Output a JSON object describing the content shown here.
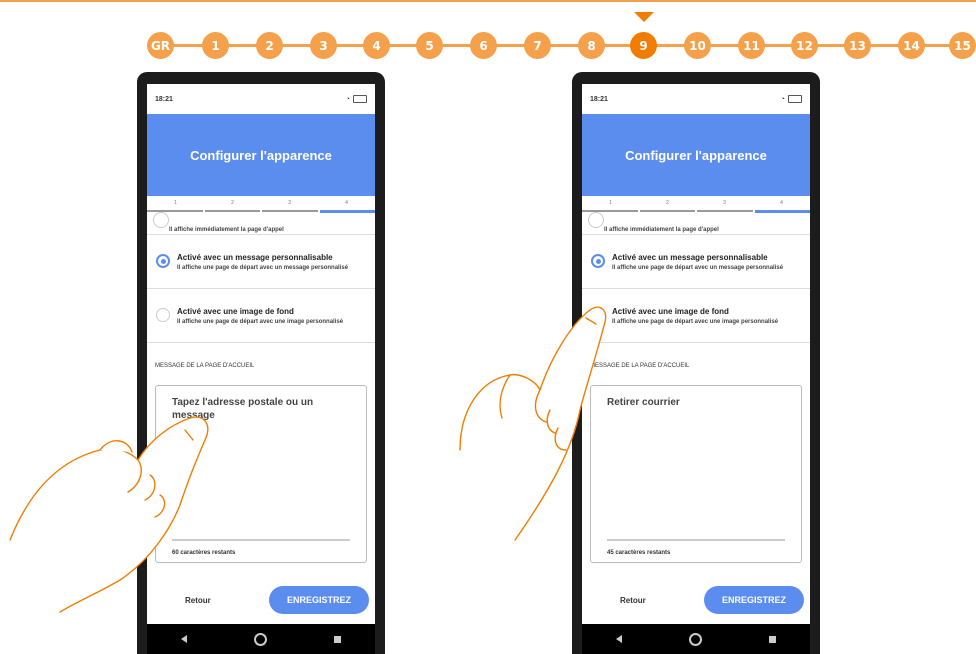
{
  "stepper": {
    "labels": [
      "GR",
      "1",
      "2",
      "3",
      "4",
      "5",
      "6",
      "7",
      "8",
      "9",
      "10",
      "11",
      "12",
      "13",
      "14",
      "15"
    ],
    "active_index": 9
  },
  "phones": [
    {
      "status_time": "18:21",
      "title": "Configurer l'apparence",
      "progress_labels": [
        "1",
        "2",
        "3",
        "4"
      ],
      "progress_active_step": 4,
      "top_option_subtitle": "Il affiche immédiatement la page d'appel",
      "option_message_title": "Activé avec un message personnalisable",
      "option_message_subtitle": "Il affiche une page de départ avec un message personnalisé",
      "option_image_title": "Activé avec une image de fond",
      "option_image_subtitle": "Il affiche une page de départ avec une image personnalisé",
      "section_label": "MESSAGE DE LA PAGE D'ACCUEIL",
      "textbox_value": "Tapez l'adresse postale ou un message",
      "counter": "60 caractères restants",
      "back_label": "Retour",
      "save_label": "ENREGISTREZ"
    },
    {
      "status_time": "18:21",
      "title": "Configurer l'apparence",
      "progress_labels": [
        "1",
        "2",
        "3",
        "4"
      ],
      "progress_active_step": 4,
      "top_option_subtitle": "Il affiche immédiatement la page d'appel",
      "option_message_title": "Activé avec un message personnalisable",
      "option_message_subtitle": "Il affiche une page de départ avec un message personnalisé",
      "option_image_title": "Activé avec une image de fond",
      "option_image_subtitle": "Il affiche une page de départ avec une image personnalisé",
      "section_label": "MESSAGE DE LA PAGE D'ACCUEIL",
      "textbox_value": "Retirer courrier",
      "counter": "45 caractères restants",
      "back_label": "Retour",
      "save_label": "ENREGISTREZ"
    }
  ],
  "colors": {
    "accent_orange": "#f07d00",
    "step_orange": "#f5a04a",
    "app_blue": "#5b8def"
  }
}
